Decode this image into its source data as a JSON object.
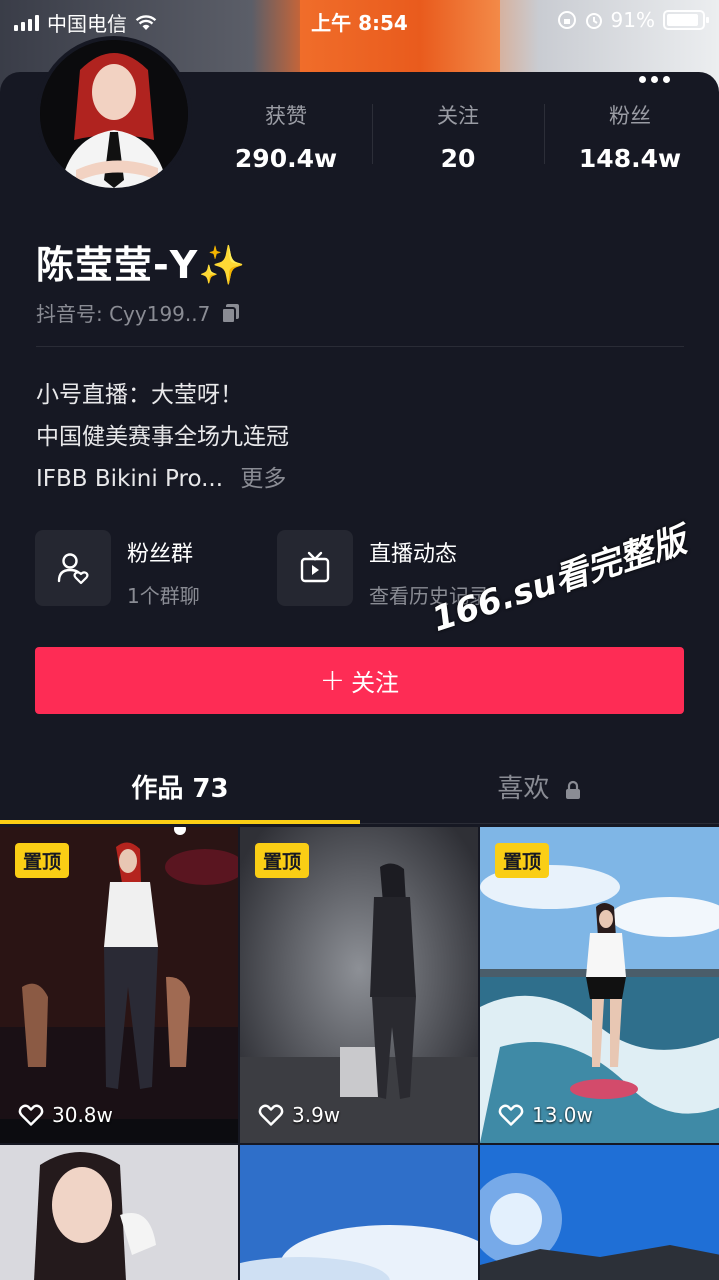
{
  "status": {
    "carrier": "中国电信",
    "time": "上午 8:54",
    "battery_percent": "91%",
    "battery_level": 0.91
  },
  "profile": {
    "name": "陈莹莹-Y✨",
    "uid_label": "抖音号: Cyy199..7",
    "stats": [
      {
        "label": "获赞",
        "value": "290.4w"
      },
      {
        "label": "关注",
        "value": "20"
      },
      {
        "label": "粉丝",
        "value": "148.4w"
      }
    ],
    "bio": [
      "小号直播：大莹呀！",
      "中国健美赛事全场九连冠",
      "IFBB Bikini Pro..."
    ],
    "bio_more": "更多"
  },
  "quick_actions": [
    {
      "title": "粉丝群",
      "subtitle": "1个群聊",
      "icon": "fan-group-icon"
    },
    {
      "title": "直播动态",
      "subtitle": "查看历史记录",
      "icon": "tv-icon"
    }
  ],
  "follow_button": {
    "plus": "+",
    "label": "关注"
  },
  "watermark": "166.su看完整版",
  "tabs": {
    "works": "作品 73",
    "likes": "喜欢"
  },
  "videos": [
    {
      "pinned": "置顶",
      "likes": "30.8w"
    },
    {
      "pinned": "置顶",
      "likes": "3.9w"
    },
    {
      "pinned": "置顶",
      "likes": "13.0w"
    }
  ],
  "colors": {
    "accent": "#fe2c55",
    "pin": "#face15",
    "background": "#161823"
  }
}
